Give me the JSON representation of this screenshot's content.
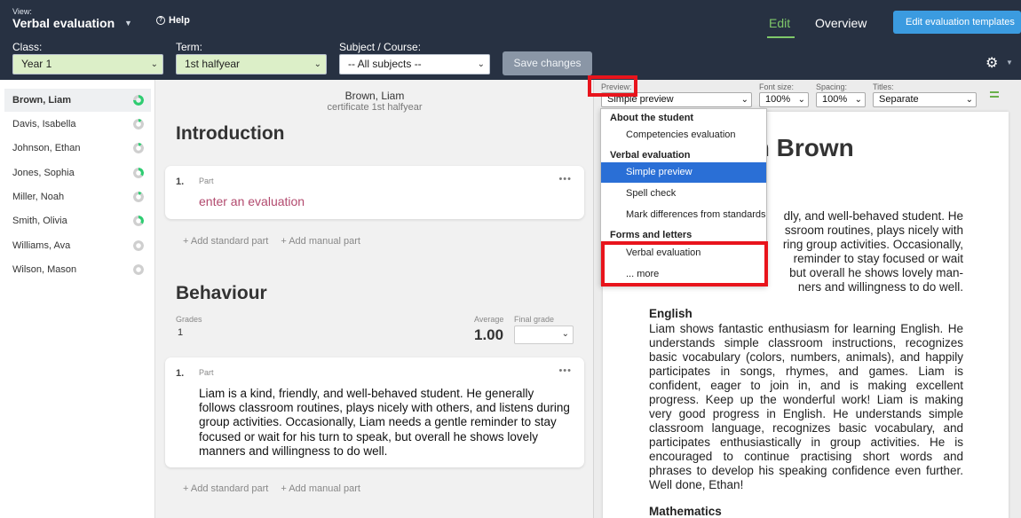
{
  "header": {
    "view_label": "View:",
    "view_value": "Verbal evaluation",
    "help_label": "Help",
    "nav_edit": "Edit",
    "nav_overview": "Overview",
    "templates_button": "Edit evaluation templates",
    "save_button": "Save changes"
  },
  "filters": {
    "class_label": "Class:",
    "class_value": "Year 1",
    "term_label": "Term:",
    "term_value": "1st halfyear",
    "subject_label": "Subject / Course:",
    "subject_value": "-- All subjects --"
  },
  "students": [
    {
      "name": "Brown, Liam",
      "progress": 0.75,
      "active": true
    },
    {
      "name": "Davis, Isabella",
      "progress": 0.1,
      "active": false
    },
    {
      "name": "Johnson, Ethan",
      "progress": 0.1,
      "active": false
    },
    {
      "name": "Jones, Sophia",
      "progress": 0.35,
      "active": false
    },
    {
      "name": "Miller, Noah",
      "progress": 0.1,
      "active": false
    },
    {
      "name": "Smith, Olivia",
      "progress": 0.35,
      "active": false
    },
    {
      "name": "Williams, Ava",
      "progress": 0,
      "active": false
    },
    {
      "name": "Wilson, Mason",
      "progress": 0,
      "active": false
    }
  ],
  "main": {
    "student_name": "Brown, Liam",
    "certificate": "certificate 1st halfyear",
    "section1_title": "Introduction",
    "card1": {
      "num": "1.",
      "part": "Part",
      "placeholder": "enter an evaluation",
      "menu": "•••"
    },
    "add_standard": "Add standard part",
    "add_manual": "Add manual part",
    "section2_title": "Behaviour",
    "grades_label": "Grades",
    "grades_value": "1",
    "average_label": "Average",
    "average_value": "1.00",
    "final_grade_label": "Final grade",
    "card2": {
      "num": "1.",
      "part": "Part",
      "menu": "•••",
      "text": "Liam is a kind, friendly, and well-behaved student. He generally follows classroom routines, plays nicely with others, and listens during group activities. Occasionally, Liam needs a gentle reminder to stay focused or wait for his turn to speak, but overall he shows lovely manners and willingness to do well."
    }
  },
  "preview_toolbar": {
    "preview_label": "Preview:",
    "preview_value": "Simple preview",
    "font_label": "Font size:",
    "font_value": "100%",
    "spacing_label": "Spacing:",
    "spacing_value": "100%",
    "titles_label": "Titles:",
    "titles_value": "Separate"
  },
  "preview_doc": {
    "title": "m Brown",
    "para1_lines": [
      "dly, and well-behaved student. He",
      "ssroom routines, plays nicely with",
      "ring group activities. Occasionally,",
      "reminder to stay focused or wait",
      "but overall he shows lovely man-",
      "ners and willingness to do well."
    ],
    "english_heading": "English",
    "english_text": "Liam shows fantastic enthusiasm for learning English. He understands simple classroom instructions, recognizes basic vocabulary (colors, numbers, animals), and happily participates in songs, rhymes, and games. Liam is confident, eager to join in, and is making excellent progress. Keep up the wonderful work! Liam is making very good progress in English. He understands simple classroom language, recognizes basic vocabulary, and participates enthusiastically in group activities. He is encouraged to continue practising short words and phrases to develop his speaking confidence even further. Well done, Ethan!",
    "math_heading": "Mathematics"
  },
  "preview_dropdown": {
    "group1": "About the student",
    "item1": "Competencies evaluation",
    "group2": "Verbal evaluation",
    "item2": "Simple preview",
    "item3": "Spell check",
    "item4": "Mark differences from standards",
    "group3": "Forms and letters",
    "item5": "Verbal evaluation",
    "item6": "... more"
  },
  "colors": {
    "topbar": "#273142",
    "accent_green": "#7fc86a",
    "button_blue": "#3b9be0",
    "selected_blue": "#2a6fd6",
    "highlight_red": "#e8141c",
    "progress_green": "#2ecc71"
  }
}
